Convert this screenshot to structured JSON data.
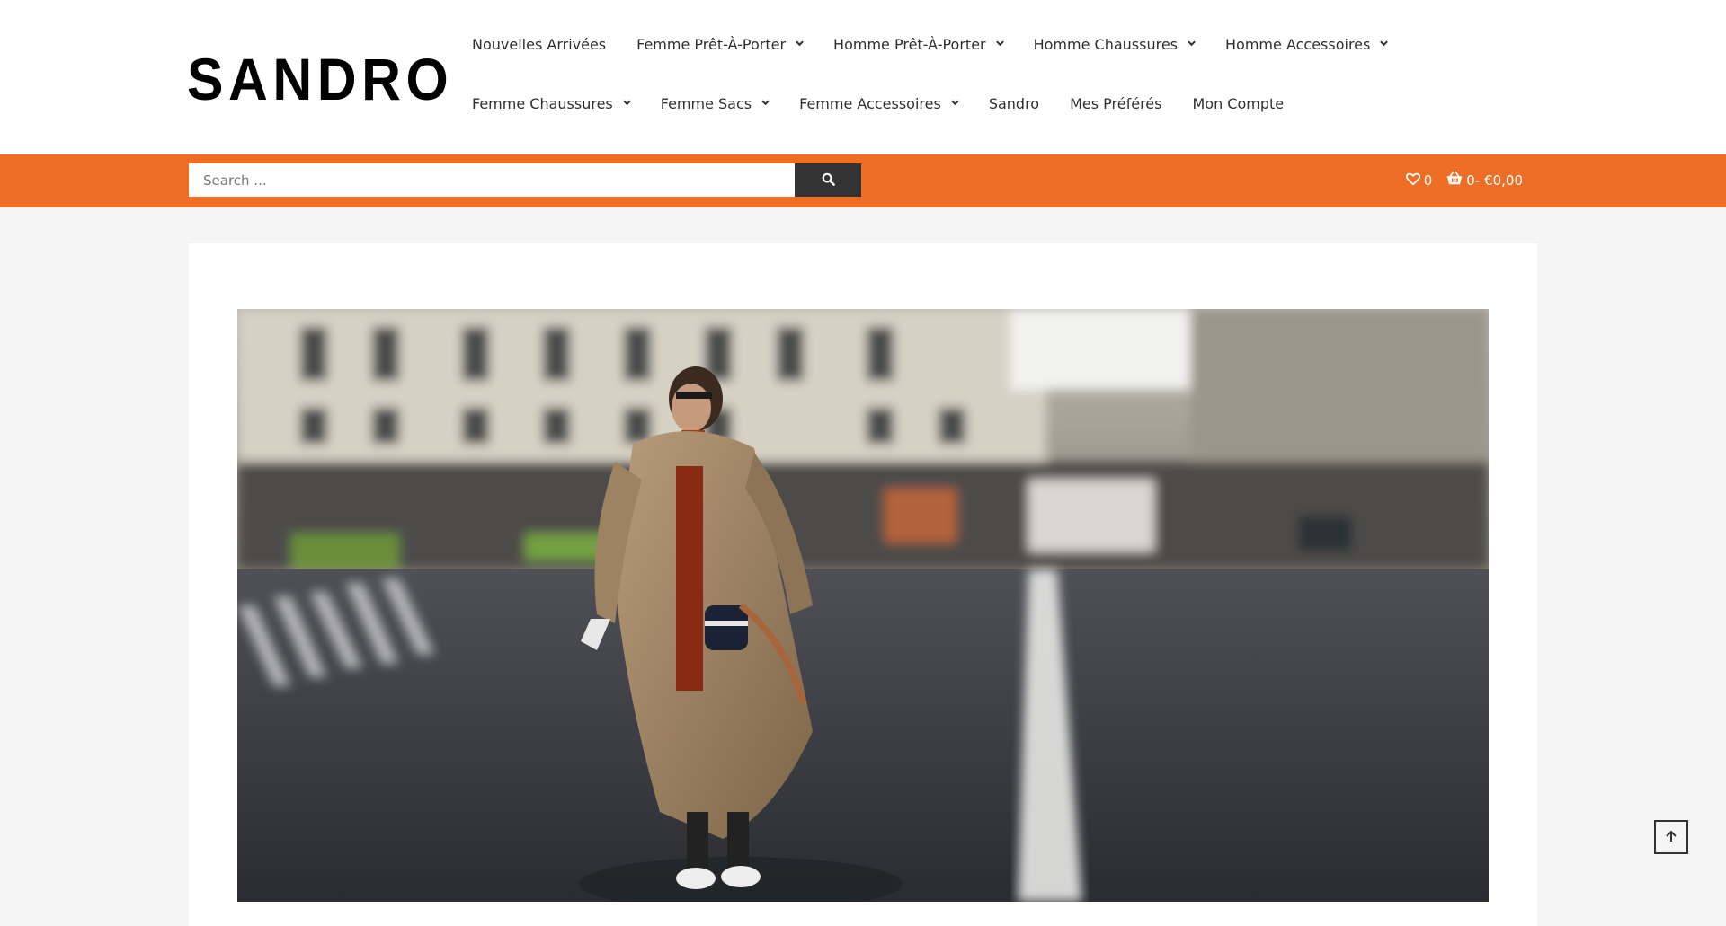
{
  "brand": {
    "logo_text": "SANDRO"
  },
  "nav": {
    "row1": [
      {
        "label": "Nouvelles Arrivées",
        "dropdown": false
      },
      {
        "label": "Femme Prêt-À-Porter",
        "dropdown": true
      },
      {
        "label": "Homme Prêt-À-Porter",
        "dropdown": true
      },
      {
        "label": "Homme Chaussures",
        "dropdown": true
      },
      {
        "label": "Homme Accessoires",
        "dropdown": true
      }
    ],
    "row2": [
      {
        "label": "Femme Chaussures",
        "dropdown": true
      },
      {
        "label": "Femme Sacs",
        "dropdown": true
      },
      {
        "label": "Femme Accessoires",
        "dropdown": true
      },
      {
        "label": "Sandro",
        "dropdown": false
      },
      {
        "label": "Mes Préférés",
        "dropdown": false
      },
      {
        "label": "Mon Compte",
        "dropdown": false
      }
    ]
  },
  "search": {
    "placeholder": "Search ...",
    "button_icon": "search-icon"
  },
  "wishlist": {
    "icon": "heart-icon",
    "count": "0"
  },
  "cart": {
    "icon": "basket-icon",
    "count": "0",
    "separator": "-",
    "total": "€0,00"
  },
  "hero": {
    "image_icon": "hero-photo"
  },
  "scroll_top": {
    "icon": "arrow-up-icon"
  },
  "colors": {
    "accent": "#ed6e24",
    "search_button": "#333333",
    "page_bg": "#f5f5f5"
  }
}
